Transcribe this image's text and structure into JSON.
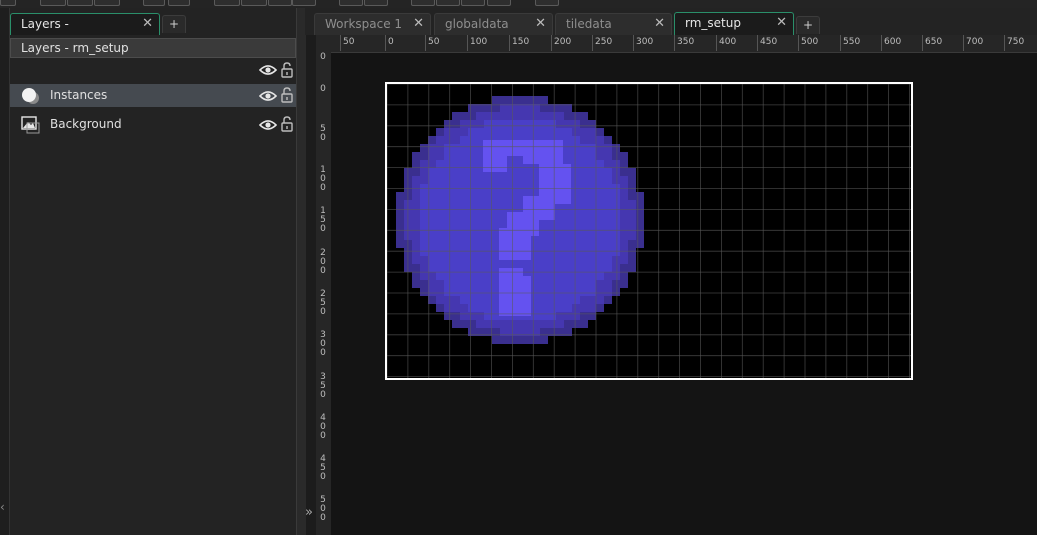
{
  "left_panel": {
    "tab_label": "Layers -",
    "tab_close": "✕",
    "add_tab": "+",
    "header": "Layers - rm_setup",
    "layers": [
      {
        "label": "Instances",
        "icon": "instance-icon",
        "selected": true
      },
      {
        "label": "Background",
        "icon": "image-icon",
        "selected": false
      }
    ]
  },
  "workspace_tabs": [
    {
      "label": "Workspace 1",
      "active": false
    },
    {
      "label": "globaldata",
      "active": false
    },
    {
      "label": "tiledata",
      "active": false
    },
    {
      "label": "rm_setup",
      "active": true
    }
  ],
  "workspace": {
    "tab_close": "✕",
    "add_tab": "+",
    "collapse_left": "‹",
    "expand_panel": "»"
  },
  "ruler": {
    "h_ticks": [
      "50",
      "0",
      "50",
      "100",
      "150",
      "200",
      "250",
      "300",
      "350",
      "400",
      "450",
      "500",
      "550",
      "600",
      "650",
      "700",
      "750"
    ],
    "v_ticks": [
      [
        "0"
      ],
      [
        "0"
      ],
      [
        "5",
        "0"
      ],
      [
        "1",
        "0",
        "0"
      ],
      [
        "1",
        "5",
        "0"
      ],
      [
        "2",
        "0",
        "0"
      ],
      [
        "2",
        "5",
        "0"
      ],
      [
        "3",
        "0",
        "0"
      ],
      [
        "3",
        "5",
        "0"
      ],
      [
        "4",
        "0",
        "0"
      ],
      [
        "4",
        "5",
        "0"
      ],
      [
        "5",
        "0",
        "0"
      ]
    ]
  },
  "room": {
    "sprite": "question-mark-placeholder",
    "sprite_colors": {
      "dark": "#3a2f8f",
      "mid": "#4a3fc8",
      "light": "#6452f0",
      "border": "#ffffff",
      "grid": "#5a5a5a"
    }
  }
}
